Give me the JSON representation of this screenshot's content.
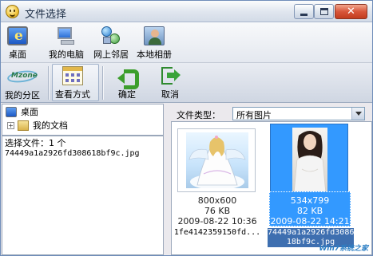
{
  "window": {
    "title": "文件选择"
  },
  "toolbar_top": {
    "items": [
      {
        "label": "桌面",
        "icon": "desktop-icon"
      },
      {
        "label": "我的电脑",
        "icon": "computer-icon"
      },
      {
        "label": "网上邻居",
        "icon": "network-icon"
      },
      {
        "label": "本地相册",
        "icon": "photo-album-icon"
      }
    ]
  },
  "toolbar_bottom": {
    "items": [
      {
        "label": "我的分区",
        "icon": "myzone-logo-icon",
        "logo_text": "Mzone"
      },
      {
        "label": "查看方式",
        "icon": "view-mode-icon"
      },
      {
        "label": "确定",
        "icon": "ok-arrow-icon"
      },
      {
        "label": "取消",
        "icon": "exit-icon"
      }
    ]
  },
  "tree": {
    "items": [
      {
        "label": "桌面"
      },
      {
        "label": "我的文档"
      }
    ]
  },
  "selection": {
    "count_text": "选择文件：1 个",
    "files": [
      "74449a1a2926fd308618bf9c.jpg"
    ]
  },
  "filter": {
    "label": "文件类型：",
    "value": "所有图片"
  },
  "thumbnails": [
    {
      "dims": "800x600",
      "size": "76 KB",
      "date": "2009-08-22 10:36",
      "name": "1fe4142359150fd...",
      "selected": false
    },
    {
      "dims": "534x799",
      "size": "82 KB",
      "date": "2009-08-22 14:21",
      "name_line1": "74449a1a2926fd3086",
      "name_line2": "18bf9c.jpg",
      "selected": true
    }
  ],
  "watermark": "Win7系统之家",
  "colors": {
    "selection": "#3399ff",
    "title_bg": "#dfe5ee",
    "ok_green": "#3c9e2c"
  }
}
